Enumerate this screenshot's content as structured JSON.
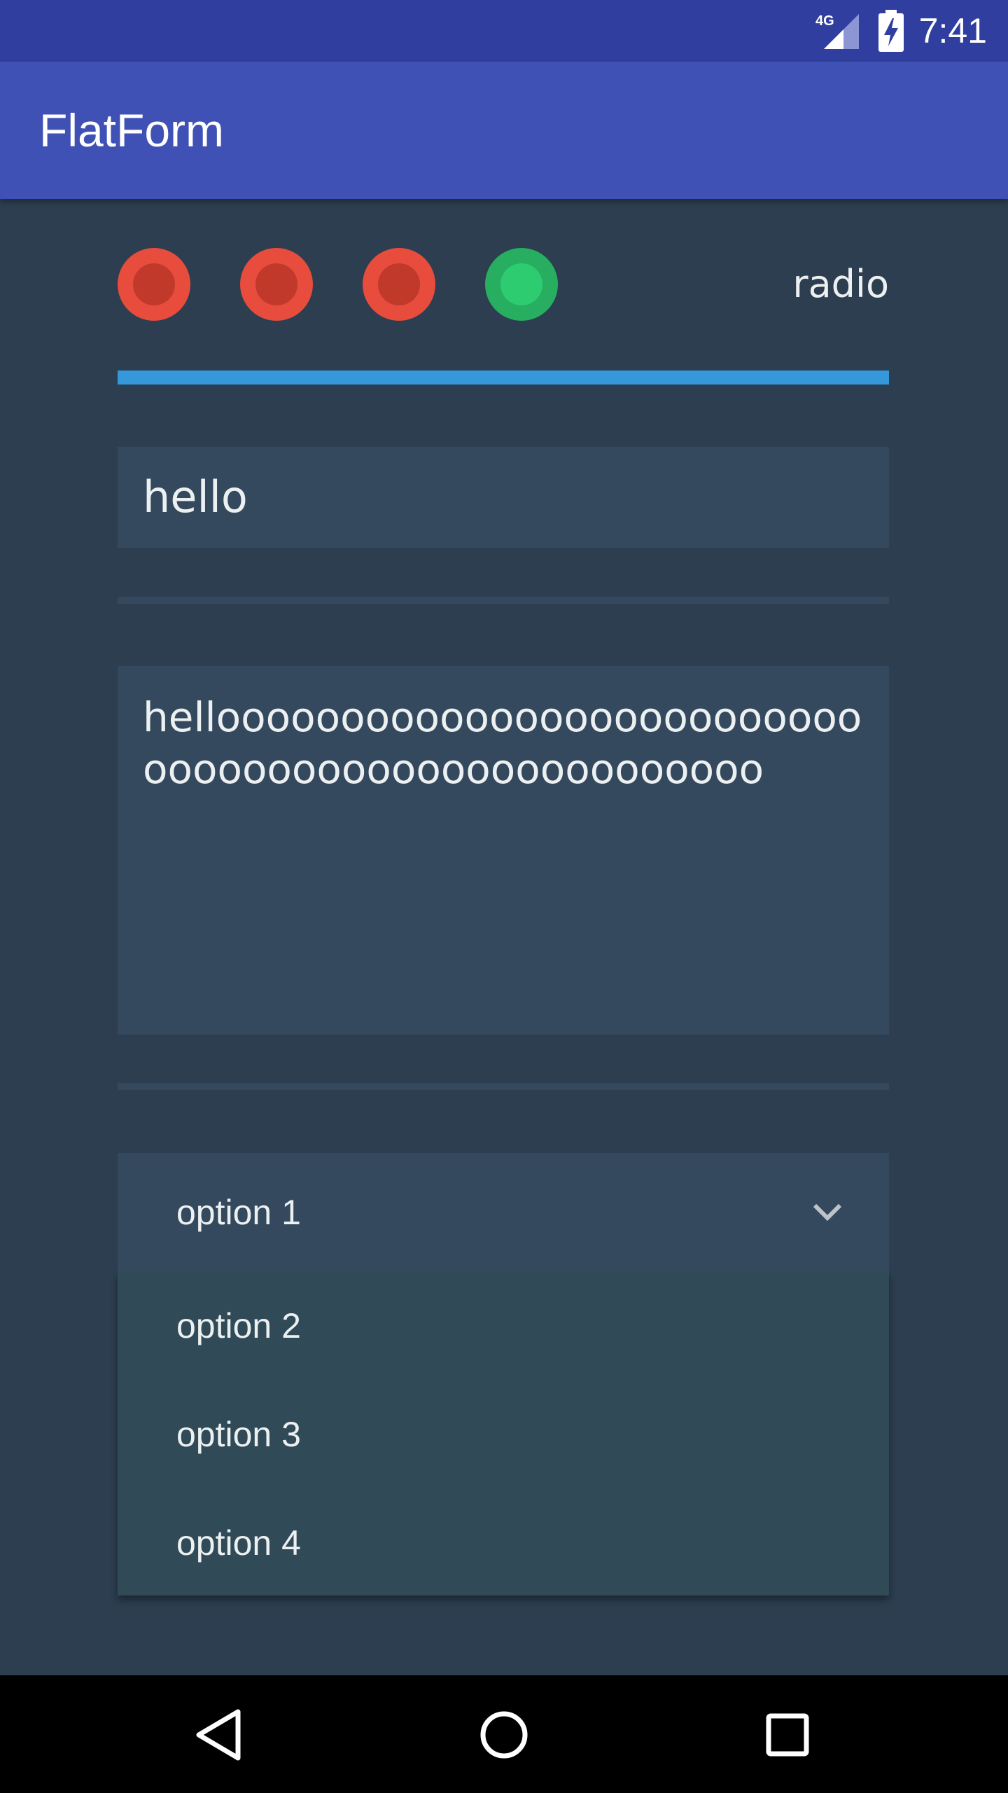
{
  "status_bar": {
    "time": "7:41",
    "network": "4G"
  },
  "app_bar": {
    "title": "FlatForm"
  },
  "radios": [
    {
      "checked": false
    },
    {
      "checked": false
    },
    {
      "checked": false
    },
    {
      "checked": true
    }
  ],
  "radio_label": "radio",
  "progress": {
    "value": 1.0,
    "color": "#3498db"
  },
  "text_input": {
    "value": "hello"
  },
  "textarea": {
    "value": "hellooooooooooooooooooooooooooooooooooooooooooooooooooo"
  },
  "select": {
    "selected": "option 1",
    "options": [
      "option 2",
      "option 3",
      "option 4"
    ]
  },
  "colors": {
    "background": "#2c3e50",
    "field": "#34495e",
    "app_bar": "#3f51b5",
    "status_bar": "#303f9f",
    "radio_off": "#e74c3c",
    "radio_on": "#27ae60"
  },
  "nav": {
    "icons": [
      "back-icon",
      "home-icon",
      "recents-icon"
    ]
  }
}
